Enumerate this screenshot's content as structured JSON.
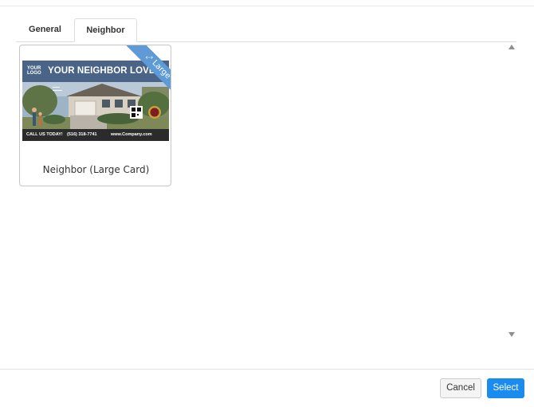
{
  "tabs": [
    {
      "label": "General",
      "active": false
    },
    {
      "label": "Neighbor",
      "active": true
    }
  ],
  "template_card": {
    "title": "Neighbor (Large Card)",
    "badge": "Large",
    "badge_icon": "resize-arrows-icon",
    "preview": {
      "logo_text": "YOUR LOGO",
      "headline": "YOUR NEIGHBOR LOVED",
      "call_text": "CALL US TODAY!",
      "phone": "(516) 318-7741",
      "website": "www.Company.com"
    }
  },
  "footer": {
    "cancel_label": "Cancel",
    "select_label": "Select"
  },
  "colors": {
    "primary_button": "#1a8cf0",
    "ribbon": "#5d9ad6",
    "preview_header": "#4a6487"
  }
}
